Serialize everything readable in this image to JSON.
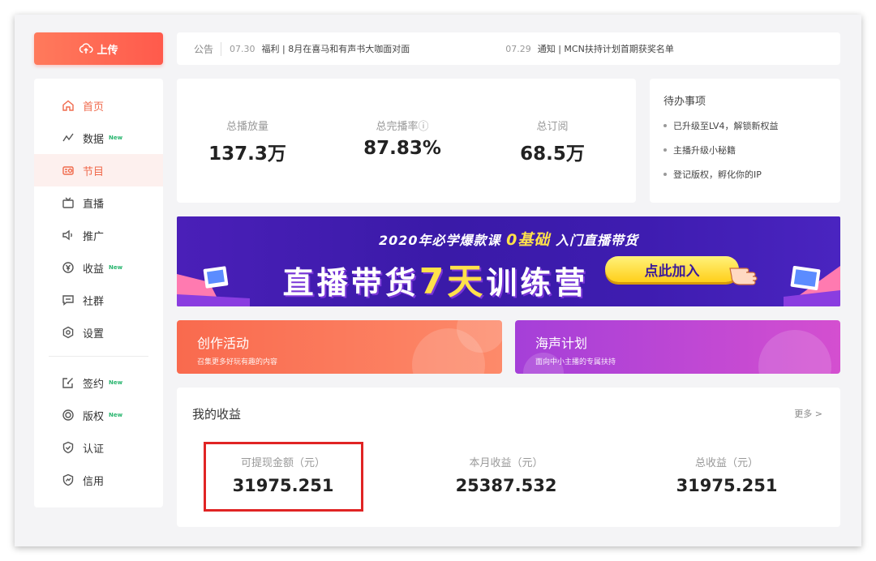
{
  "upload": {
    "label": "上传"
  },
  "sidebar": {
    "items": [
      {
        "label": "首页",
        "icon": "home-icon",
        "new": ""
      },
      {
        "label": "数据",
        "icon": "chart-icon",
        "new": "New"
      },
      {
        "label": "节目",
        "icon": "radio-icon",
        "new": ""
      },
      {
        "label": "直播",
        "icon": "tv-icon",
        "new": ""
      },
      {
        "label": "推广",
        "icon": "speaker-icon",
        "new": ""
      },
      {
        "label": "收益",
        "icon": "yen-icon",
        "new": "New"
      },
      {
        "label": "社群",
        "icon": "chat-icon",
        "new": ""
      },
      {
        "label": "设置",
        "icon": "gear-icon",
        "new": ""
      },
      {
        "label": "签约",
        "icon": "edit-icon",
        "new": "New"
      },
      {
        "label": "版权",
        "icon": "copyright-icon",
        "new": "New"
      },
      {
        "label": "认证",
        "icon": "shield-icon",
        "new": ""
      },
      {
        "label": "信用",
        "icon": "credit-icon",
        "new": ""
      }
    ]
  },
  "notice": {
    "label": "公告",
    "items": [
      {
        "date": "07.30",
        "text": "福利 | 8月在喜马和有声书大咖面对面"
      },
      {
        "date": "07.29",
        "text": "通知 | MCN扶持计划首期获奖名单"
      }
    ]
  },
  "stats": [
    {
      "label": "总播放量",
      "value": "137.3万"
    },
    {
      "label": "总完播率ⓘ",
      "value": "87.83%"
    },
    {
      "label": "总订阅",
      "value": "68.5万"
    }
  ],
  "todo": {
    "title": "待办事项",
    "items": [
      "已升级至LV4，解锁新权益",
      "主播升级小秘籍",
      "登记版权，孵化你的IP"
    ]
  },
  "banner": {
    "sub_prefix": "2020年必学爆款课",
    "sub_highlight": "0基础",
    "sub_suffix": "入门直播带货",
    "main_prefix": "直播带货",
    "main_highlight": "7天",
    "main_suffix": "训练营",
    "button": "点此加入"
  },
  "promos": [
    {
      "title": "创作活动",
      "subtitle": "召集更多好玩有趣的内容"
    },
    {
      "title": "海声计划",
      "subtitle": "面向中小主播的专属扶持"
    }
  ],
  "earnings": {
    "title": "我的收益",
    "more": "更多 >",
    "metrics": [
      {
        "label": "可提现金额（元）",
        "value": "31975.251"
      },
      {
        "label": "本月收益（元）",
        "value": "25387.532"
      },
      {
        "label": "总收益（元）",
        "value": "31975.251"
      }
    ]
  },
  "colors": {
    "accent": "#f06a4c",
    "highlight_box": "#e02424",
    "banner_bg": "#3a1aa8"
  }
}
